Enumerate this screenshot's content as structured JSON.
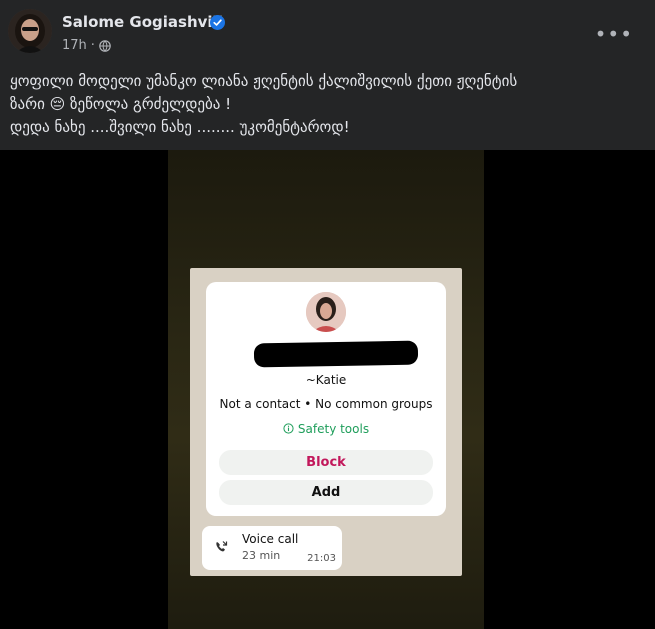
{
  "post": {
    "author": "Salome Gogiashvili",
    "time": "17h",
    "privacy_icon": "globe-icon",
    "text_lines": [
      "ყოფილი მოდელი უმანკო ლიანა ჟღენტის ქალიშვილის ქეთი ჟღენტის",
      "ზარი 😔 ზეწოლა გრძელდება !",
      "დედა ნახე ....შვილი ნახე ........ უკომენტაროდ!"
    ]
  },
  "contact_card": {
    "name": "~Katie",
    "status": "Not a contact • No common groups",
    "safety_label": "Safety tools",
    "block_label": "Block",
    "add_label": "Add"
  },
  "call": {
    "title": "Voice call",
    "duration": "23 min",
    "time": "21:03"
  },
  "colors": {
    "background": "#242526",
    "verified": "#1b74e4",
    "block_red": "#c2185b",
    "safety_green": "#1f9e5b"
  }
}
